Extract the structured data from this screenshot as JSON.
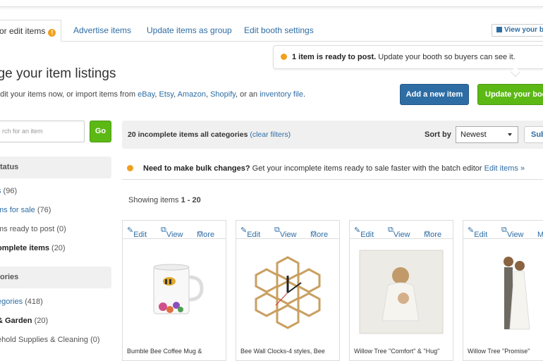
{
  "tabs": [
    {
      "label": "or edit items",
      "active": true
    },
    {
      "label": "Advertise items"
    },
    {
      "label": "Update items as group"
    },
    {
      "label": "Edit booth settings"
    }
  ],
  "view_booth": "View your b",
  "notice": {
    "bold": "1 item is ready to post.",
    "text": " Update your booth so buyers can see it."
  },
  "page_title": "age your item listings",
  "subline": {
    "prefix": "edit your items now, or import items from ",
    "links": [
      "eBay",
      "Etsy",
      "Amazon",
      "Shopify"
    ],
    "or_an": ", or an ",
    "inventory": "inventory file",
    "end": "."
  },
  "buttons": {
    "add_new": "Add a new item",
    "update_booth": "Update your boo"
  },
  "search": {
    "placeholder": "rch for an item",
    "go": "Go"
  },
  "sidebar": {
    "status_header": "tatus",
    "status_items": [
      {
        "link": "s",
        "count": " (96)"
      },
      {
        "link": "ms for sale",
        "count": " (76)"
      },
      {
        "plain": "ms ready to post",
        "count": " (0)"
      },
      {
        "bold": "omplete items",
        "count": " (20)"
      }
    ],
    "categories_header": "ories",
    "category_items": [
      {
        "link": "egories",
        "count": " (418)"
      },
      {
        "bold": "& Garden",
        "count": " (20)"
      },
      {
        "plain": "ehold Supplies & Cleaning",
        "count": " (0)"
      }
    ]
  },
  "filter": {
    "text": "20 incomplete items all categories ",
    "clear": "(clear filters)",
    "sort_label": "Sort by",
    "sort_value": "Newest",
    "sub_btn": "Sub"
  },
  "bulk": {
    "bold": "Need to make bulk changes?",
    "text": " Get your incomplete items ready to sale faster with the batch editor ",
    "link": "Edit items »"
  },
  "showing": {
    "prefix": "Showing items ",
    "range": "1 - 20"
  },
  "card_actions": {
    "edit": "Edit",
    "view": "View",
    "more": "More"
  },
  "cards": [
    {
      "title": "Bumble Bee Coffee Mug &",
      "image": "mug"
    },
    {
      "title": "Bee Wall Clocks-4 styles, Bee",
      "image": "clock"
    },
    {
      "title": "Willow Tree \"Comfort\" & \"Hug\"",
      "image": "figurine"
    },
    {
      "title": "Willow Tree \"Promise\"",
      "image": "couple"
    }
  ],
  "colors": {
    "link": "#2e6da4",
    "green": "#5cb815",
    "blue_btn": "#2e6da4",
    "warn": "#f0a020"
  }
}
